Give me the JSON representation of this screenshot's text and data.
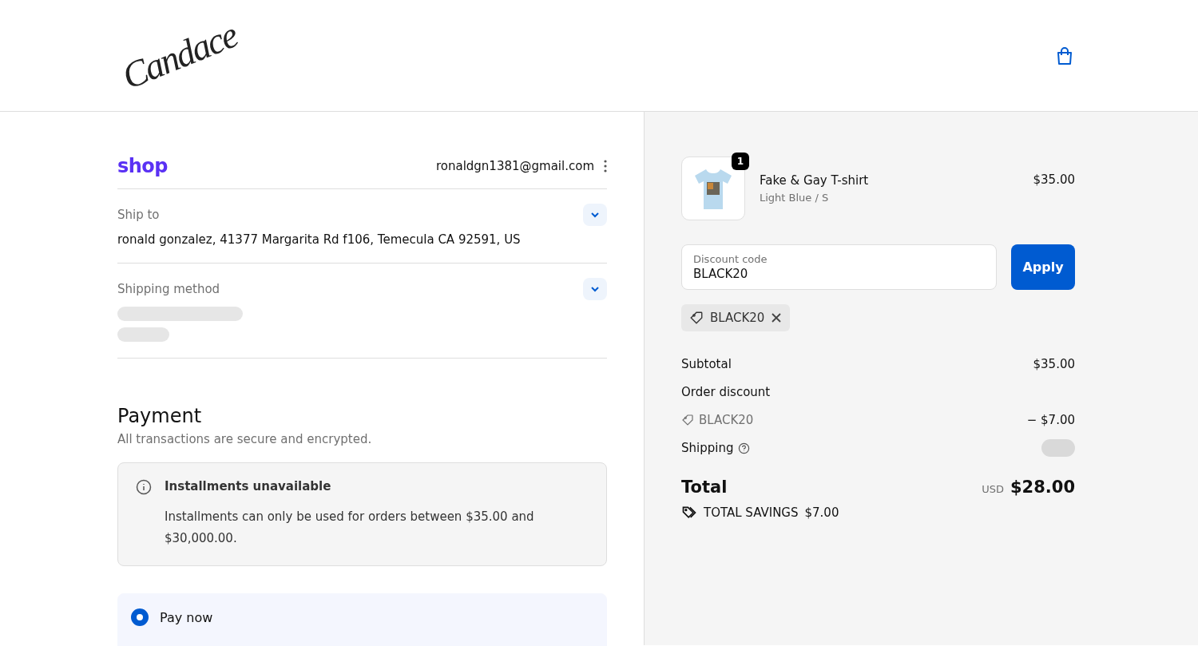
{
  "header": {
    "logo": "Candace"
  },
  "account": {
    "brand": "shop",
    "email": "ronaldgn1381@gmail.com"
  },
  "sections": [
    {
      "kind": "address",
      "label": "Ship to",
      "value": "ronald gonzalez, 41377 Margarita Rd f106, Temecula CA 92591, US",
      "expanded": false
    },
    {
      "kind": "loading",
      "label": "Shipping method",
      "expanded": false
    }
  ],
  "payment": {
    "title": "Payment",
    "subtitle": "All transactions are secure and encrypted.",
    "notice": {
      "title": "Installments unavailable",
      "text": "Installments can only be used for orders between $35.00 and $30,000.00."
    },
    "options": [
      {
        "label": "Pay now",
        "selected": true
      }
    ]
  },
  "summary": {
    "items": [
      {
        "name": "Fake & Gay T-shirt",
        "variant": "Light Blue / S",
        "price": "$35.00",
        "quantity": "1"
      }
    ],
    "discount": {
      "placeholder": "Discount code",
      "value": "BLACK20",
      "button": "Apply",
      "applied": "BLACK20"
    },
    "lines": [
      {
        "kind": "plain",
        "label": "Subtotal",
        "value": "$35.00"
      },
      {
        "kind": "heading",
        "label": "Order discount"
      },
      {
        "kind": "code",
        "label": "BLACK20",
        "value": "− $7.00"
      },
      {
        "kind": "loading",
        "label": "Shipping"
      }
    ],
    "total": {
      "label": "Total",
      "currency": "USD",
      "amount": "$28.00"
    },
    "savings": {
      "label": "TOTAL SAVINGS",
      "amount": "$7.00"
    }
  }
}
